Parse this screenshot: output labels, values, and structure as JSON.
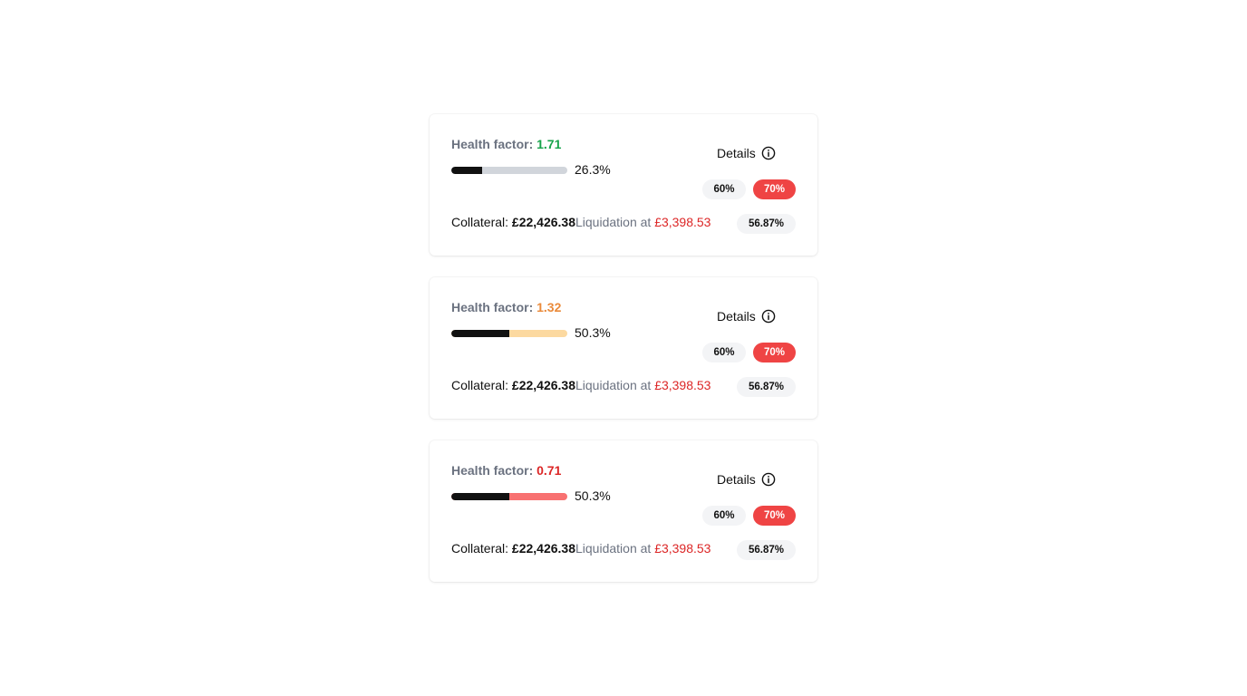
{
  "colors": {
    "health_good": "#16a34a",
    "health_warn": "#ea8a3a",
    "health_bad": "#dc2626",
    "track_good": "#d1d5db",
    "track_warn": "#fcd9a0",
    "track_bad": "#f87171",
    "chip_red": "#ef4444"
  },
  "cards": [
    {
      "health_label": "Health factor:",
      "health_value": "1.71",
      "health_status": "good",
      "progress_fraction": 0.263,
      "progress_text": "26.3%",
      "details_label": "Details",
      "chip_low": "60%",
      "chip_high": "70%",
      "collateral_label": "Collateral:",
      "collateral_value": "£22,426.38",
      "liquidation_label": "Liquidation at",
      "liquidation_value": "£3,398.53",
      "ltv_chip": "56.87%",
      "icon": "info-icon"
    },
    {
      "health_label": "Health factor:",
      "health_value": "1.32",
      "health_status": "warn",
      "progress_fraction": 0.503,
      "progress_text": "50.3%",
      "details_label": "Details",
      "chip_low": "60%",
      "chip_high": "70%",
      "collateral_label": "Collateral:",
      "collateral_value": "£22,426.38",
      "liquidation_label": "Liquidation at",
      "liquidation_value": "£3,398.53",
      "ltv_chip": "56.87%",
      "icon": "info-icon"
    },
    {
      "health_label": "Health factor:",
      "health_value": "0.71",
      "health_status": "bad",
      "progress_fraction": 0.503,
      "progress_text": "50.3%",
      "details_label": "Details",
      "chip_low": "60%",
      "chip_high": "70%",
      "collateral_label": "Collateral:",
      "collateral_value": "£22,426.38",
      "liquidation_label": "Liquidation at",
      "liquidation_value": "£3,398.53",
      "ltv_chip": "56.87%",
      "icon": "info-icon"
    }
  ]
}
